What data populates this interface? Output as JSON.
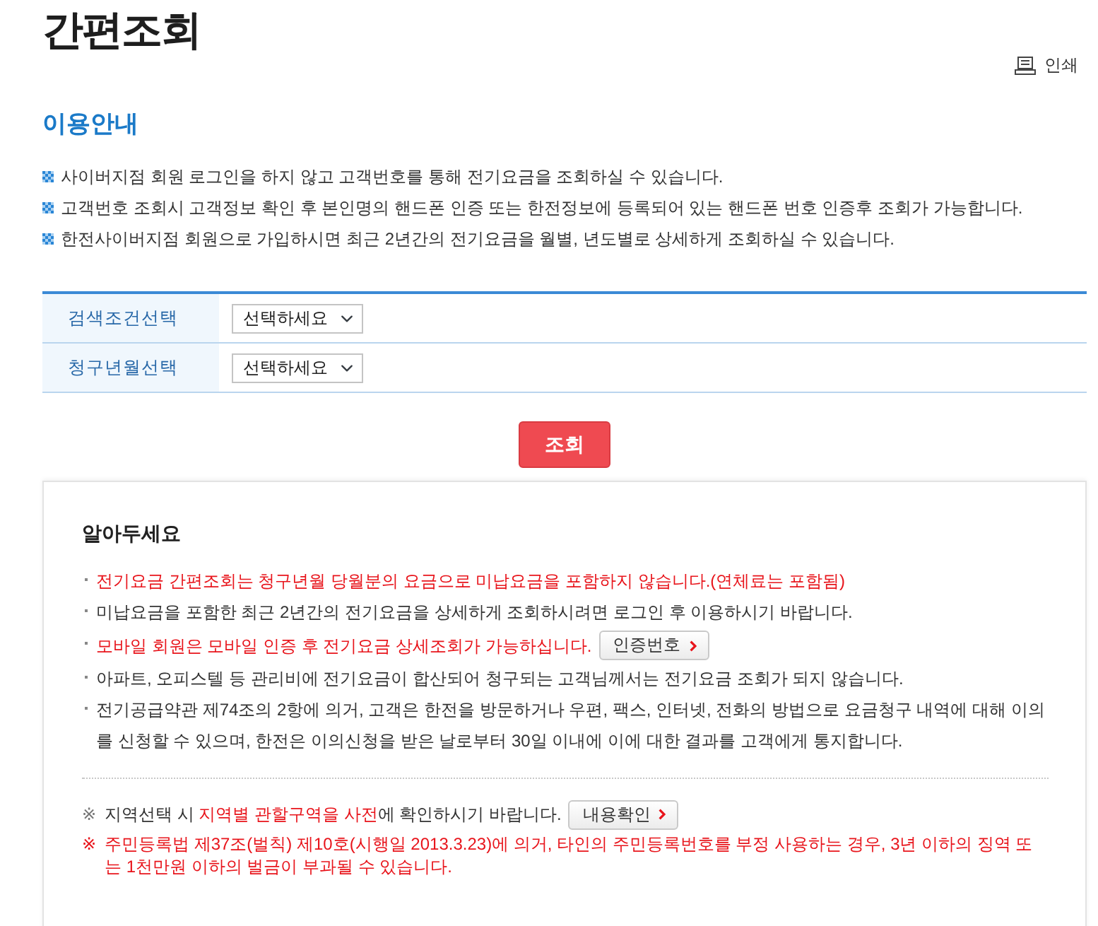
{
  "title": "간편조회",
  "print_link": {
    "label": "인쇄"
  },
  "guide": {
    "heading": "이용안내",
    "items": [
      "사이버지점 회원 로그인을 하지 않고 고객번호를 통해 전기요금을 조회하실 수 있습니다.",
      "고객번호 조회시 고객정보 확인 후 본인명의 핸드폰 인증 또는 한전정보에 등록되어 있는 핸드폰 번호 인증후 조회가 가능합니다.",
      "한전사이버지점 회원으로 가입하시면 최근 2년간의 전기요금을 월별, 년도별로 상세하게 조회하실 수 있습니다."
    ]
  },
  "search_form": {
    "rows": [
      {
        "label": "검색조건선택",
        "value": "선택하세요"
      },
      {
        "label": "청구년월선택",
        "value": "선택하세요"
      }
    ],
    "submit": "조회"
  },
  "notice": {
    "heading": "알아두세요",
    "items": [
      {
        "text": "전기요금 간편조회는 청구년월 당월분의 요금으로 미납요금을 포함하지 않습니다.(연체료는 포함됨)",
        "highlight": true
      },
      {
        "text": "미납요금을 포함한 최근 2년간의 전기요금을 상세하게 조회하시려면 로그인 후 이용하시기 바랍니다.",
        "highlight": false
      },
      {
        "text": "모바일 회원은 모바일 인증 후 전기요금 상세조회가 가능하십니다.",
        "highlight": true,
        "button": "인증번호"
      },
      {
        "text": "아파트, 오피스텔 등 관리비에 전기요금이 합산되어 청구되는 고객님께서는 전기요금 조회가 되지 않습니다.",
        "highlight": false
      },
      {
        "text": "전기공급약관 제74조의 2항에 의거, 고객은 한전을 방문하거나 우편, 팩스, 인터넷, 전화의 방법으로 요금청구 내역에 대해 이의를 신청할 수 있으며, 한전은 이의신청을 받은 날로부터 30일 이내에 이에 대한 결과를 고객에게 통지합니다.",
        "highlight": false
      }
    ],
    "notes": [
      {
        "symbol": "※",
        "symbol_highlight": false,
        "parts": [
          {
            "text": "지역선택 시 ",
            "highlight": false
          },
          {
            "text": "지역별 관할구역을 사전",
            "highlight": true
          },
          {
            "text": "에 확인하시기 바랍니다.",
            "highlight": false
          }
        ],
        "button": "내용확인"
      },
      {
        "symbol": "※",
        "symbol_highlight": true,
        "parts": [
          {
            "text": "주민등록법 제37조(벌칙) 제10호(시행일 2013.3.23)에 의거, 타인의 주민등록번호를 부정 사용하는 경우, 3년 이하의 징역 또는 1천만원 이하의 벌금이 부과될 수 있습니다.",
            "highlight": true
          }
        ]
      }
    ]
  }
}
